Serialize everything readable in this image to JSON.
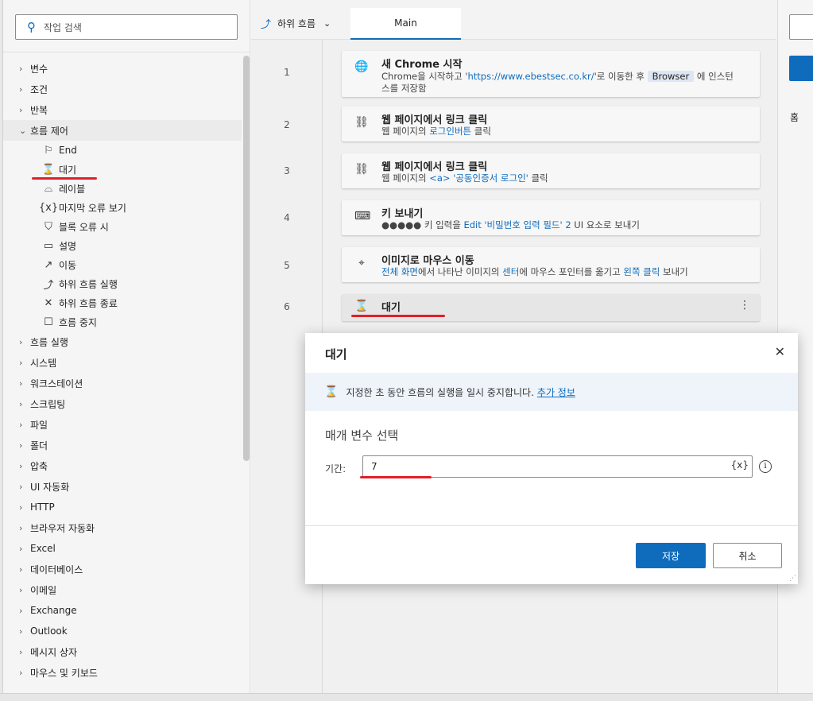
{
  "actions_pane": {
    "search_placeholder": "작업 검색",
    "categories_top": [
      {
        "label": "변수"
      },
      {
        "label": "조건"
      },
      {
        "label": "반복"
      },
      {
        "label": "흐름 제어"
      }
    ],
    "flow_control_items": [
      {
        "label": "End",
        "icon": "flag-icon"
      },
      {
        "label": "대기",
        "icon": "hourglass-icon"
      },
      {
        "label": "레이블",
        "icon": "label-icon"
      },
      {
        "label": "마지막 오류 보기",
        "icon": "variable-icon"
      },
      {
        "label": "블록 오류 시",
        "icon": "shield-icon"
      },
      {
        "label": "설명",
        "icon": "comment-icon"
      },
      {
        "label": "이동",
        "icon": "arrow-icon"
      },
      {
        "label": "하위 흐름 실행",
        "icon": "subflow-icon"
      },
      {
        "label": "하위 흐름 종료",
        "icon": "x-icon"
      },
      {
        "label": "흐름 중지",
        "icon": "square-icon"
      }
    ],
    "categories_bottom": [
      {
        "label": "흐름 실행"
      },
      {
        "label": "시스템"
      },
      {
        "label": "워크스테이션"
      },
      {
        "label": "스크립팅"
      },
      {
        "label": "파일"
      },
      {
        "label": "폴더"
      },
      {
        "label": "압축"
      },
      {
        "label": "UI 자동화"
      },
      {
        "label": "HTTP"
      },
      {
        "label": "브라우저 자동화"
      },
      {
        "label": "Excel"
      },
      {
        "label": "데이터베이스"
      },
      {
        "label": "이메일"
      },
      {
        "label": "Exchange"
      },
      {
        "label": "Outlook"
      },
      {
        "label": "메시지 상자"
      },
      {
        "label": "마우스 및 키보드"
      }
    ]
  },
  "designer": {
    "subflows_label": "하위 흐름",
    "tab_main": "Main",
    "steps": [
      {
        "n": "1",
        "title": "새 Chrome 시작",
        "d1": "Chrome을 시작하고 '",
        "link": "https://www.ebestsec.co.kr/",
        "d2": "'로 이동한 후 ",
        "tag": "Browser",
        "d3": " 에 인스턴",
        "d4": "스를 저장함"
      },
      {
        "n": "2",
        "title": "웹 페이지에서 링크 클릭",
        "d1": "웹 페이지의 ",
        "link": "로그인버튼",
        "d2": " 클릭"
      },
      {
        "n": "3",
        "title": "웹 페이지에서 링크 클릭",
        "d1": "웹 페이지의 ",
        "link": "<a> '공동인증서 로그인'",
        "d2": " 클릭"
      },
      {
        "n": "4",
        "title": "키 보내기",
        "d1": "●●●●● 키 입력을 ",
        "link": "Edit '비밀번호 입력 필드' 2",
        "d2": " UI 요소로 보내기"
      },
      {
        "n": "5",
        "title": "이미지로 마우스 이동",
        "link1": "전체 화면",
        "d1": "에서 나타난 이미지의 ",
        "link2": "센터",
        "d2": "에 마우스 포인터를 옮기고 ",
        "link3": "왼쪽 클릭",
        "d3": " 보내기"
      },
      {
        "n": "6",
        "title": "대기"
      }
    ]
  },
  "right_pane": {
    "home_label": "홈"
  },
  "dialog": {
    "title": "대기",
    "info_text": "지정한 초 동안 흐름의 실행을 일시 중지합니다.",
    "info_link": "추가 정보",
    "section_title": "매개 변수 선택",
    "duration_label": "기간:",
    "duration_value": "7",
    "var_button": "{x}",
    "info_icon": "i",
    "save_label": "저장",
    "cancel_label": "취소"
  }
}
